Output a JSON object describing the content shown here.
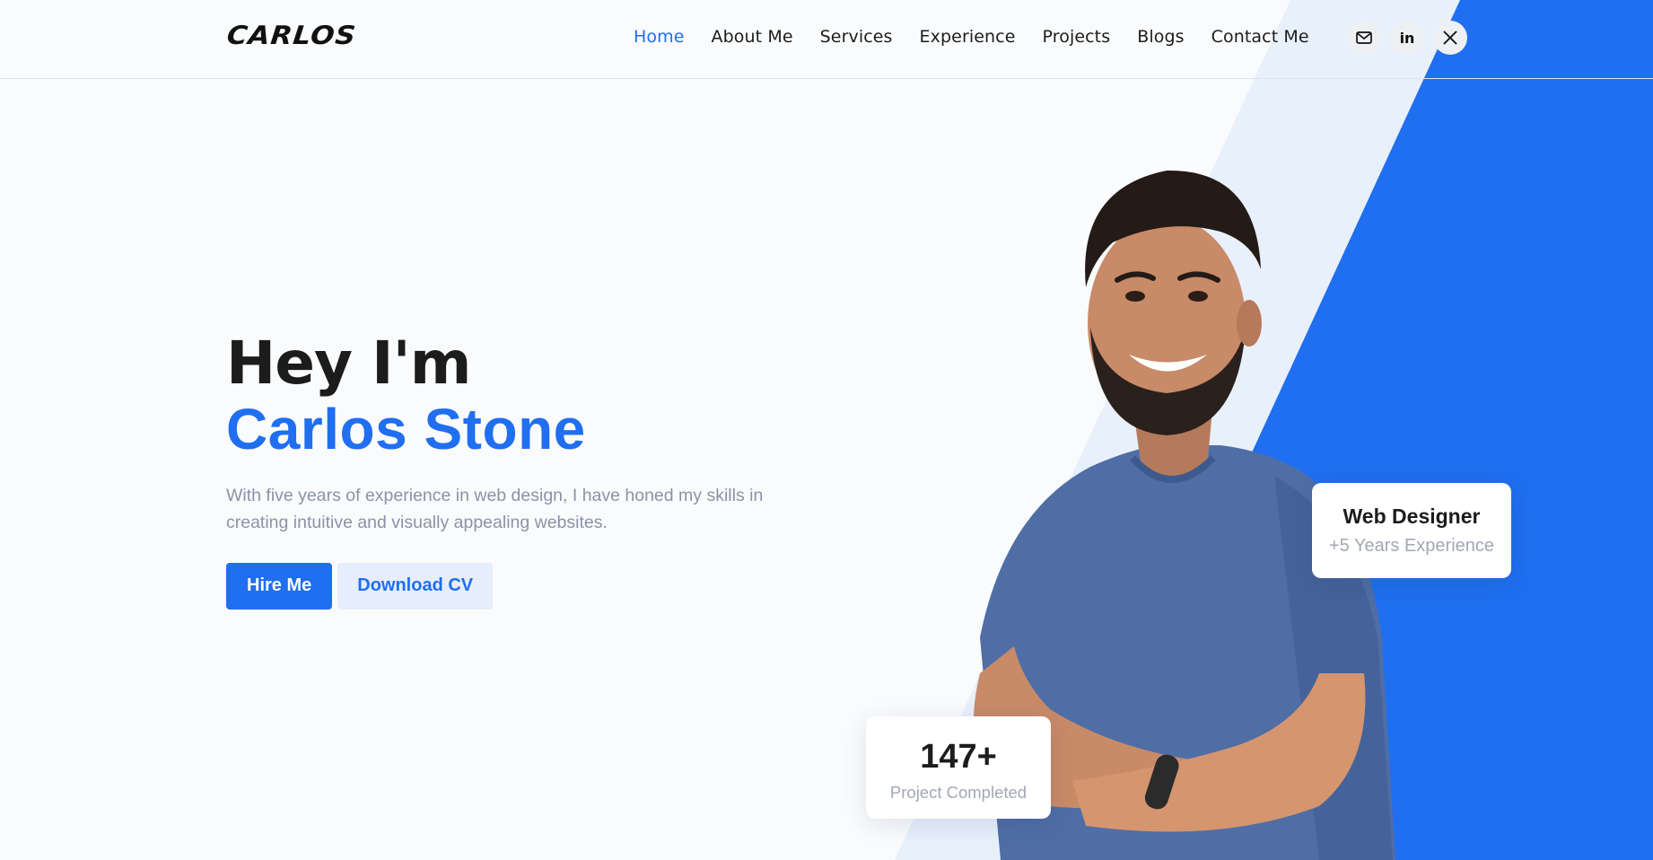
{
  "header": {
    "logo": "CARLOS",
    "nav": [
      "Home",
      "About Me",
      "Services",
      "Experience",
      "Projects",
      "Blogs",
      "Contact Me"
    ],
    "active_nav": "Home",
    "socials": [
      {
        "icon": "mail-icon"
      },
      {
        "icon": "linkedin-icon",
        "label": "in"
      },
      {
        "icon": "x-icon"
      }
    ]
  },
  "hero": {
    "greeting": "Hey I'm",
    "name": "Carlos Stone",
    "description": "With five years of experience in web design, I have honed my skills in creating intuitive and visually appealing websites.",
    "primary_button": "Hire Me",
    "secondary_button": "Download CV"
  },
  "cards": {
    "role_title": "Web Designer",
    "role_subtitle": "+5 Years Experience",
    "stat_value": "147+",
    "stat_label": "Project Completed"
  },
  "colors": {
    "accent": "#1f6ff0",
    "accent_light": "#e8f0fc",
    "background": "#fafbfd",
    "text_muted": "#8a93a6"
  }
}
